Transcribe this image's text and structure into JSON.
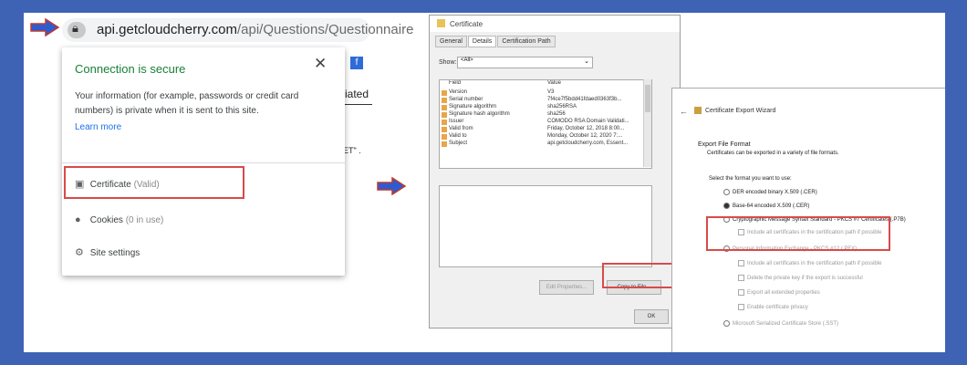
{
  "browser": {
    "address_domain": "api.getcloudcherry.com",
    "address_path": "/api/Questions/Questionnaire",
    "bg_tab_fragment": "ciated",
    "bg_text_fragment": "ET\" ."
  },
  "popup": {
    "title": "Connection is secure",
    "description": "Your information (for example, passwords or credit card numbers) is private when it is sent to this site.",
    "learn_more": "Learn more",
    "items": [
      {
        "label": "Certificate",
        "status": "(Valid)",
        "icon": "certificate-icon"
      },
      {
        "label": "Cookies",
        "status": "(0 in use)",
        "icon": "cookie-icon"
      },
      {
        "label": "Site settings",
        "status": "",
        "icon": "gear-icon"
      }
    ]
  },
  "certificate_dialog": {
    "title": "Certificate",
    "tabs": [
      "General",
      "Details",
      "Certification Path"
    ],
    "active_tab": "Details",
    "show_label": "Show:",
    "show_value": "<All>",
    "columns": [
      "Field",
      "Value"
    ],
    "rows": [
      {
        "field": "Version",
        "value": "V3"
      },
      {
        "field": "Serial number",
        "value": "7f4ce7f5bdd41fdaed0363f3b..."
      },
      {
        "field": "Signature algorithm",
        "value": "sha256RSA"
      },
      {
        "field": "Signature hash algorithm",
        "value": "sha256"
      },
      {
        "field": "Issuer",
        "value": "COMODO RSA Domain Validati..."
      },
      {
        "field": "Valid from",
        "value": "Friday, October 12, 2018 8:00..."
      },
      {
        "field": "Valid to",
        "value": "Monday, October 12, 2020 7:..."
      },
      {
        "field": "Subject",
        "value": "api.getcloudcherry.com, Essent..."
      }
    ],
    "edit_properties": "Edit Properties...",
    "copy_to_file": "Copy to File...",
    "ok": "OK"
  },
  "export_wizard": {
    "title": "Certificate Export Wizard",
    "section_title": "Export File Format",
    "section_desc": "Certificates can be exported in a variety of file formats.",
    "prompt": "Select the format you want to use:",
    "options": [
      {
        "label": "DER encoded binary X.509 (.CER)",
        "selected": false
      },
      {
        "label": "Base-64 encoded X.509 (.CER)",
        "selected": true
      },
      {
        "label": "Cryptographic Message Syntax Standard - PKCS #7 Certificates (.P7B)",
        "selected": false
      }
    ],
    "p7b_sub": "Include all certificates in the certification path if possible",
    "pfx_label": "Personal Information Exchange - PKCS #12 (.PFX)",
    "pfx_subs": [
      "Include all certificates in the certification path if possible",
      "Delete the private key if the export is successful",
      "Export all extended properties",
      "Enable certificate privacy"
    ],
    "sst_label": "Microsoft Serialized Certificate Store (.SST)"
  },
  "colors": {
    "frame": "#3f63b4",
    "arrow": "#2f5bd1",
    "highlight": "#d94a4a",
    "secure_green": "#188038",
    "link_blue": "#1a73e8"
  }
}
